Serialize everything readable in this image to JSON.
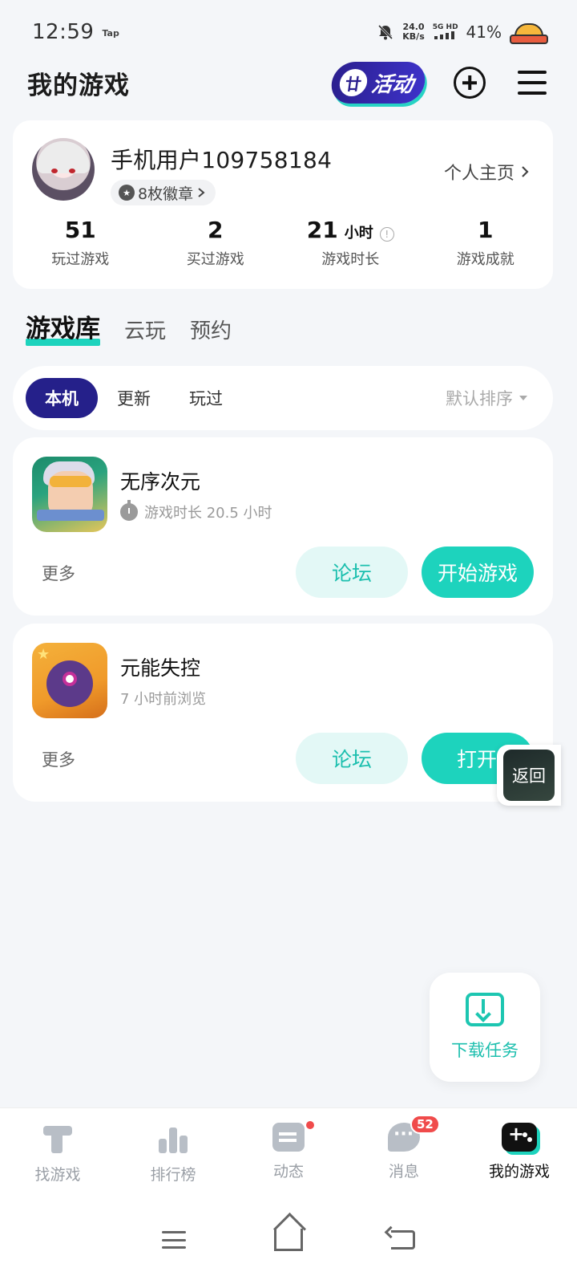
{
  "status_bar": {
    "time": "12:59",
    "app_tag": "Tap",
    "net_speed_value": "24.0",
    "net_speed_unit": "KB/s",
    "network": "5G HD",
    "battery": "41%"
  },
  "header": {
    "title": "我的游戏",
    "activity_label": "活动",
    "activity_icon": "廿"
  },
  "profile": {
    "name": "手机用户109758184",
    "badges": "8枚徽章",
    "homepage_link": "个人主页",
    "stats": [
      {
        "value": "51",
        "unit": "",
        "label": "玩过游戏"
      },
      {
        "value": "2",
        "unit": "",
        "label": "买过游戏"
      },
      {
        "value": "21",
        "unit": "小时",
        "label": "游戏时长"
      },
      {
        "value": "1",
        "unit": "",
        "label": "游戏成就"
      }
    ]
  },
  "library_tabs": [
    {
      "label": "游戏库",
      "active": true
    },
    {
      "label": "云玩",
      "active": false
    },
    {
      "label": "预约",
      "active": false
    }
  ],
  "filter": {
    "chips": [
      {
        "label": "本机",
        "active": true
      },
      {
        "label": "更新",
        "active": false
      },
      {
        "label": "玩过",
        "active": false
      }
    ],
    "sort_label": "默认排序"
  },
  "games": [
    {
      "name": "无序次元",
      "meta": "游戏时长 20.5 小时",
      "more": "更多",
      "forum": "论坛",
      "action": "开始游戏"
    },
    {
      "name": "元能失控",
      "meta": "7 小时前浏览",
      "more": "更多",
      "forum": "论坛",
      "action": "打开"
    }
  ],
  "back_float": {
    "label": "返回"
  },
  "download_float": {
    "label": "下载任务"
  },
  "bottom_nav": [
    {
      "label": "找游戏",
      "icon": "find-game-icon"
    },
    {
      "label": "排行榜",
      "icon": "ranking-icon"
    },
    {
      "label": "动态",
      "icon": "feed-icon"
    },
    {
      "label": "消息",
      "icon": "message-icon",
      "badge": "52"
    },
    {
      "label": "我的游戏",
      "icon": "my-games-icon",
      "active": true
    }
  ],
  "colors": {
    "accent": "#1dd3bd",
    "brand_dark": "#25208a",
    "badge_red": "#f04b4b"
  }
}
